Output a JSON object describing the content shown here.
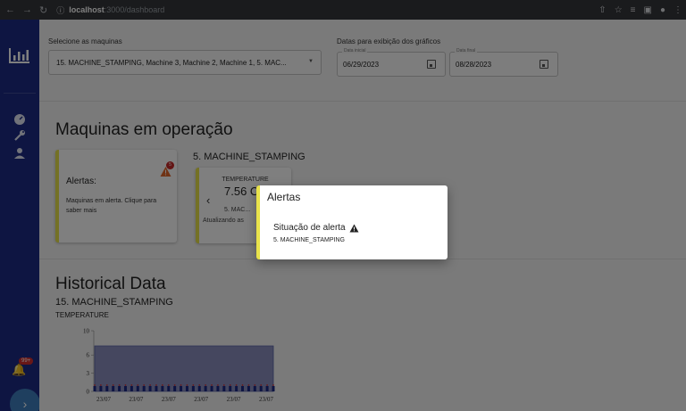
{
  "browser": {
    "url_host": "localhost",
    "url_path": ":3000/dashboard"
  },
  "sidebar": {
    "notification_count": "99+"
  },
  "filters": {
    "machines_label": "Selecione as maquinas",
    "machines_value": "15. MACHINE_STAMPING, Machine 3, Machine 2, Machine 1, 5. MAC...",
    "dates_label": "Datas para exibição dos gráficos",
    "start_date": {
      "legend": "Data inicial",
      "value": "06/29/2023"
    },
    "end_date": {
      "legend": "Data final",
      "value": "08/28/2023"
    }
  },
  "operation": {
    "heading": "Maquinas em operação",
    "machine_title": "5. MACHINE_STAMPING",
    "alert_card": {
      "title": "Alertas:",
      "badge": "5",
      "description": "Maquinas em alerta. Clique para saber mais"
    },
    "metric_card": {
      "name": "TEMPERATURE",
      "value": "7.56 C",
      "machine": "5. MAC...",
      "updating": "Atualizando as"
    }
  },
  "history": {
    "heading": "Historical Data",
    "machine": "15. MACHINE_STAMPING",
    "metric": "TEMPERATURE"
  },
  "chart_data": {
    "type": "area",
    "ylim": [
      0,
      10
    ],
    "yticks": [
      0,
      3,
      6,
      10
    ],
    "x_tick_labels": [
      "23/07",
      "23/07",
      "23/07",
      "23/07",
      "23/07",
      "23/07"
    ],
    "series": [
      {
        "values": [
          7.5,
          7.5,
          7.5,
          7.5,
          7.5,
          7.5,
          7.5,
          7.5,
          7.5,
          7.5,
          7.5,
          7.5,
          7.5,
          7.5,
          7.5,
          7.5,
          7.5,
          7.5,
          7.5,
          7.5,
          7.5,
          7.5,
          7.5,
          7.5,
          7.5,
          7.5,
          7.5,
          7.5,
          7.5,
          7.5
        ]
      }
    ],
    "colors": {
      "fill": "#8b8fbf",
      "stroke": "#5560a8",
      "markers": "#1d2b84",
      "threshold": "#d32f2f"
    }
  },
  "dialog": {
    "title": "Alertas",
    "status": "Situação de alerta",
    "machine": "5. MACHINE_STAMPING"
  }
}
